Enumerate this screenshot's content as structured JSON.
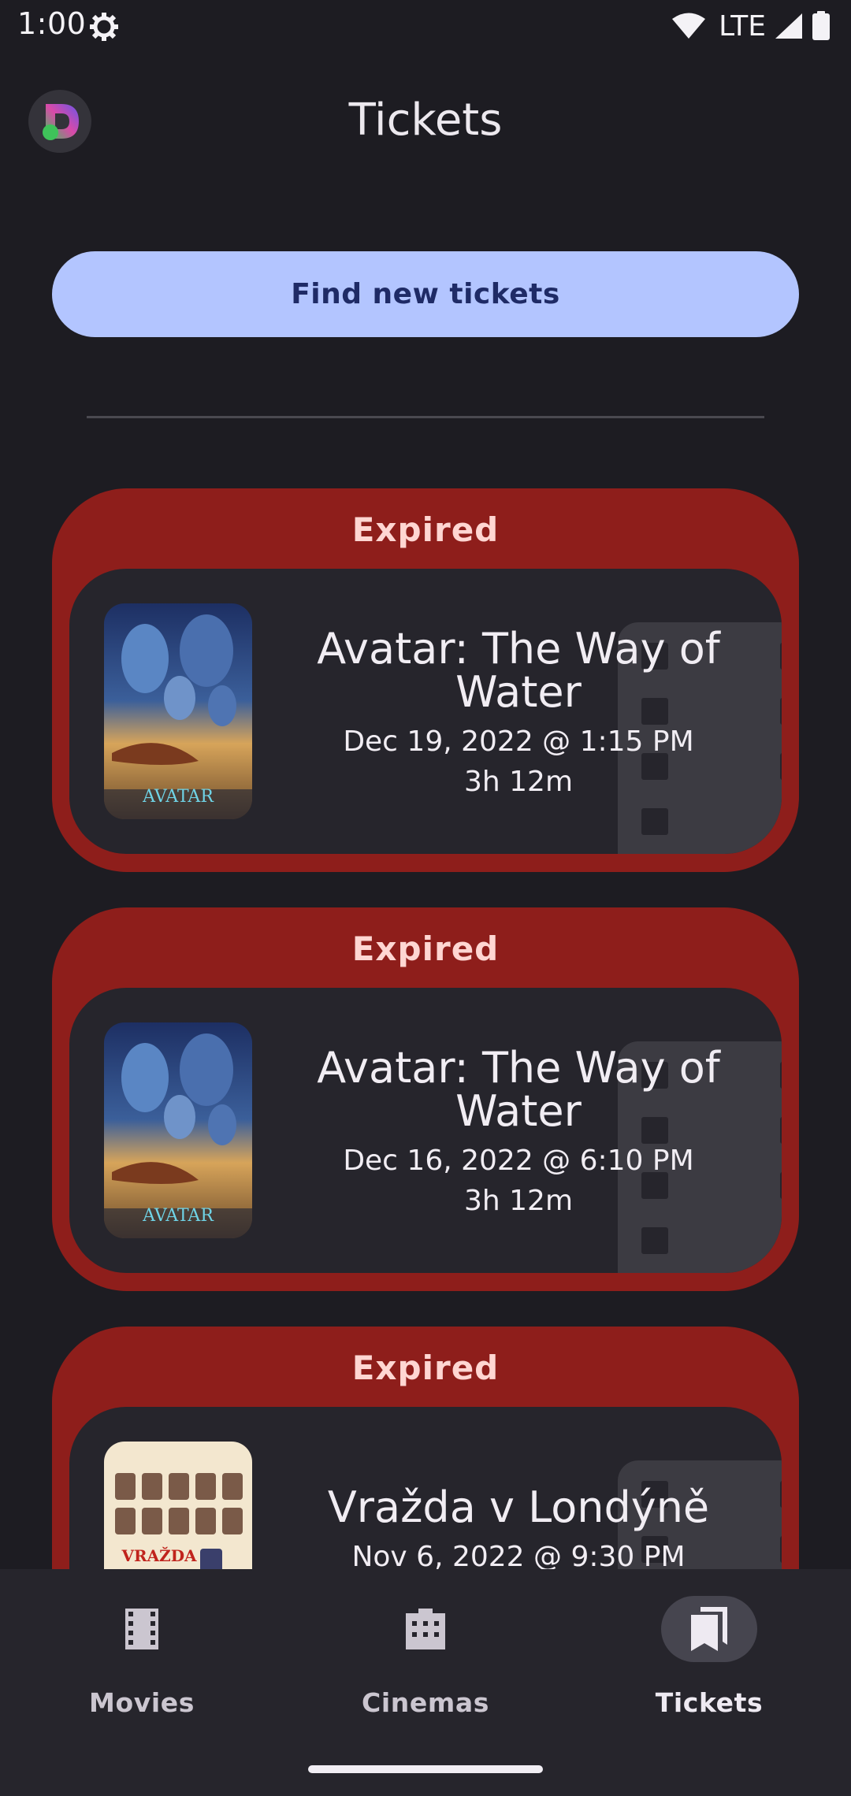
{
  "status_bar": {
    "time": "1:00",
    "network": "LTE",
    "icons": [
      "settings-gear-icon",
      "wifi-icon",
      "signal-icon",
      "battery-icon"
    ]
  },
  "header": {
    "title": "Tickets",
    "logo_icon": "app-logo-icon"
  },
  "actions": {
    "find_tickets_label": "Find new tickets"
  },
  "tickets": [
    {
      "status": "Expired",
      "title": "Avatar: The Way of Water",
      "datetime": "Dec 19, 2022 @ 1:15 PM",
      "duration": "3h 12m",
      "poster_text": "AVATAR"
    },
    {
      "status": "Expired",
      "title": "Avatar: The Way of Water",
      "datetime": "Dec 16, 2022 @ 6:10 PM",
      "duration": "3h 12m",
      "poster_text": "AVATAR"
    },
    {
      "status": "Expired",
      "title": "Vražda v Londýně",
      "datetime": "Nov 6, 2022 @ 9:30 PM",
      "duration": "",
      "poster_text": "VRAŽDA"
    }
  ],
  "bottom_nav": {
    "items": [
      {
        "label": "Movies",
        "icon": "film-icon",
        "active": false
      },
      {
        "label": "Cinemas",
        "icon": "cinema-icon",
        "active": false
      },
      {
        "label": "Tickets",
        "icon": "ticket-bookmark-icon",
        "active": true
      }
    ]
  },
  "colors": {
    "background": "#1d1c22",
    "accent_button": "#b3c5ff",
    "expired_card": "#8e1e1b",
    "inner_card": "#26252c",
    "nav_bar": "#26252c"
  }
}
